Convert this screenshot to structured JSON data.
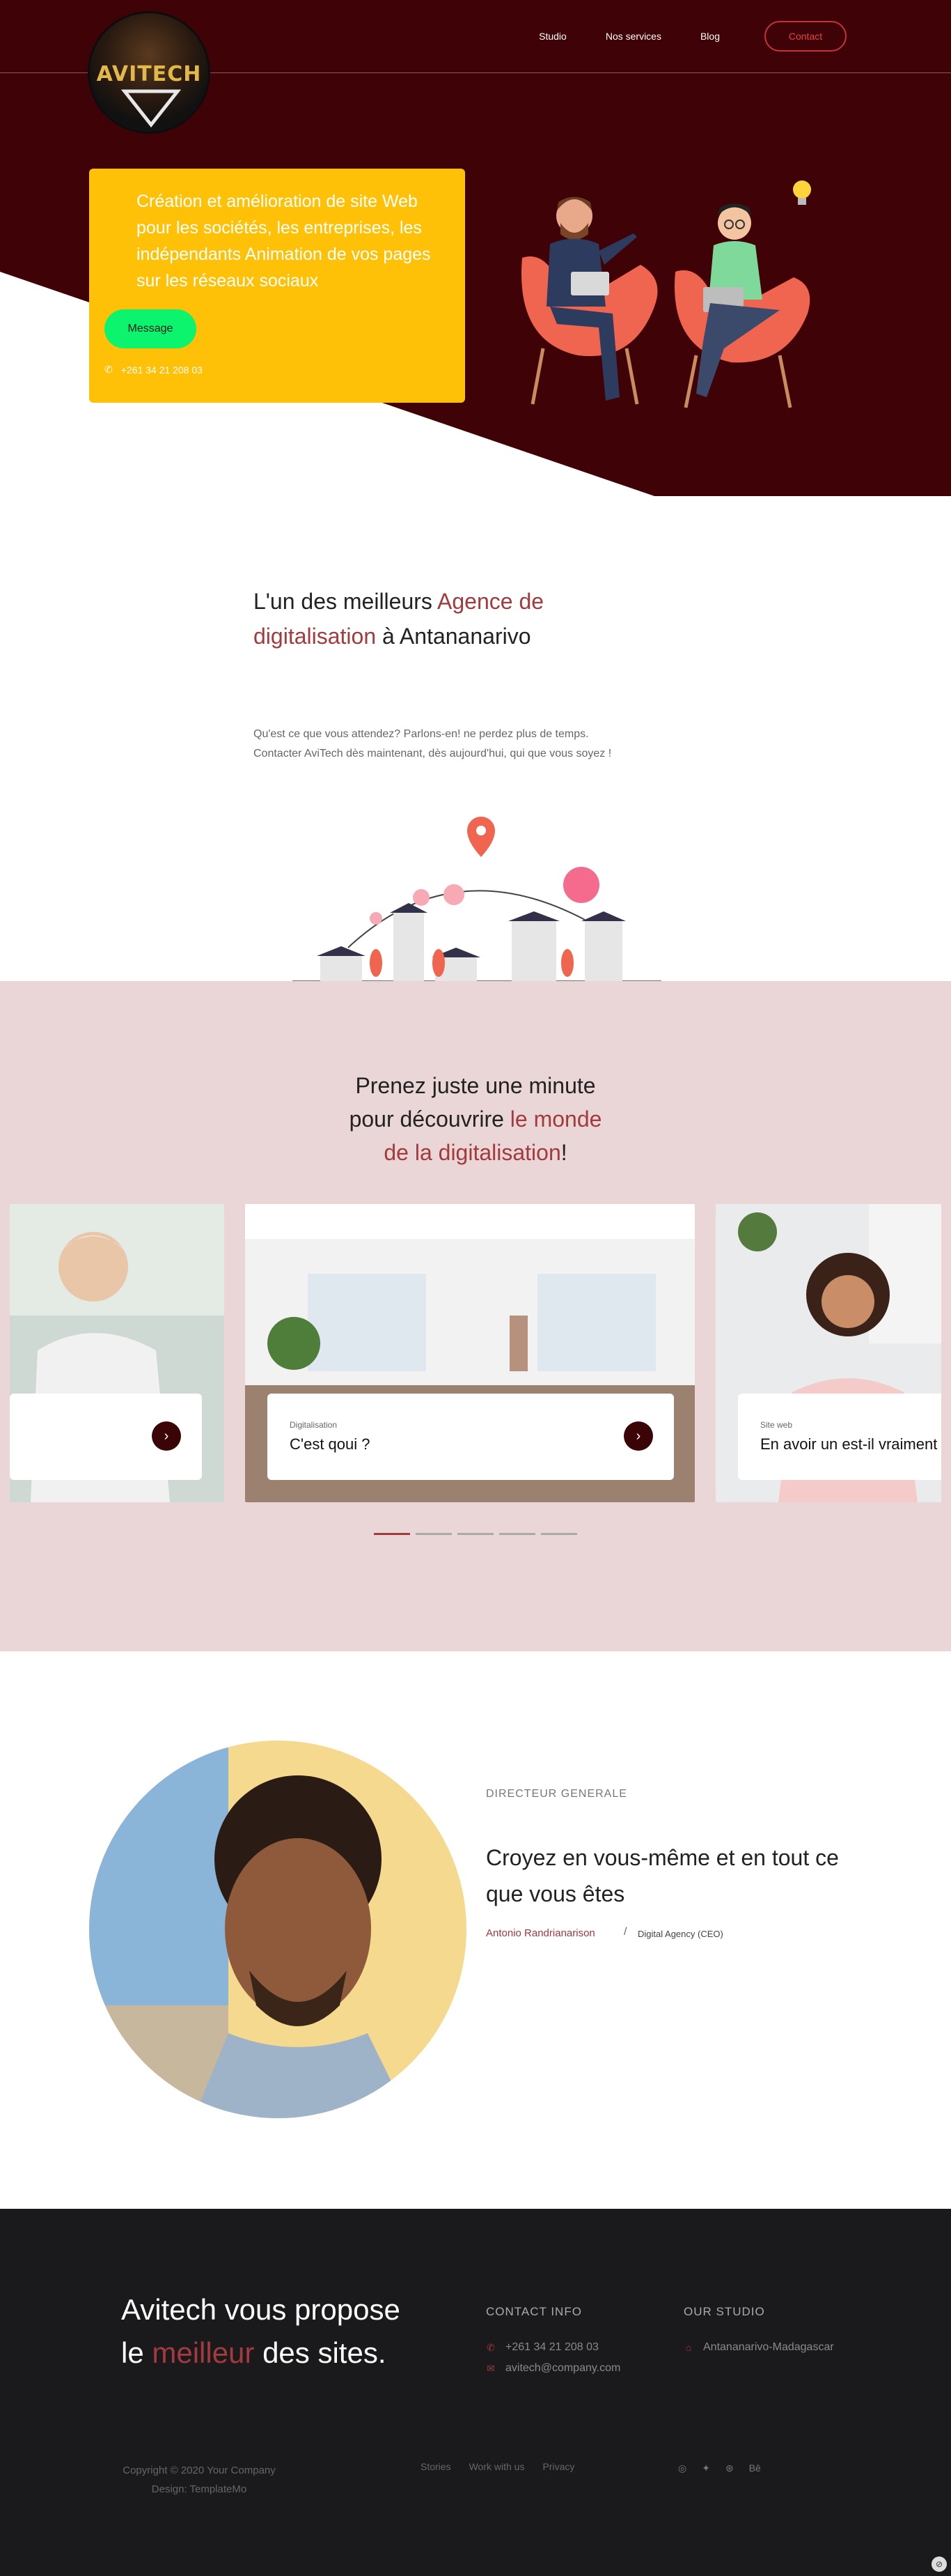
{
  "header": {
    "logo_text": "AVITECH",
    "nav": [
      "Studio",
      "Nos services",
      "Blog"
    ],
    "contact_label": "Contact"
  },
  "hero": {
    "headline": "Création et amélioration de site Web pour les sociétés, les entreprises, les indépendants Animation de vos pages sur les réseaux sociaux",
    "button_label": "Message",
    "phone": "+261 34 21 208 03"
  },
  "agency": {
    "title_1": "L'un des meilleurs ",
    "title_accent": "Agence de digitalisation",
    "title_2": " à Antananarivo",
    "text_1": "Qu'est ce que vous attendez? Parlons-en! ne perdez plus de temps.",
    "text_2": "Contacter AviTech dès maintenant, dès aujourd'hui, qui que vous soyez !"
  },
  "discover": {
    "line_1": "Prenez juste une minute",
    "line_2": "pour découvrire ",
    "accent_1": "le monde",
    "accent_2": "de la digitalisation",
    "end": "!",
    "slides": [
      {
        "category": "",
        "title": ""
      },
      {
        "category": "Digitalisation",
        "title": "C'est qoui ?"
      },
      {
        "category": "Site web",
        "title": "En avoir un est-il vraiment"
      }
    ]
  },
  "director": {
    "role": "DIRECTEUR GENERALE",
    "quote": "Croyez en vous-même et en tout ce que vous êtes",
    "name": "Antonio Randrianarison",
    "separator": "/",
    "company": "Digital Agency (CEO)"
  },
  "footer": {
    "title_1": "Avitech vous propose",
    "title_2": "le ",
    "title_accent": "meilleur",
    "title_3": " des sites.",
    "contact_head": "CONTACT INFO",
    "phone": "+261 34 21 208 03",
    "email": "avitech@company.com",
    "studio_head": "OUR STUDIO",
    "address": "Antananarivo-Madagascar",
    "copyright_1": "Copyright © 2020 Your Company",
    "copyright_2": "Design: TemplateMo",
    "links": [
      "Stories",
      "Work with us",
      "Privacy"
    ],
    "social": [
      "instagram-icon",
      "twitter-icon",
      "dribbble-icon",
      "behance-icon"
    ],
    "behance_label": "Bē"
  },
  "colors": {
    "hero_bg": "#3f0206",
    "card_yellow": "#fec107",
    "button_green": "#0cf36e",
    "accent": "#a23a3e",
    "pink_bg": "#ead6d6",
    "footer_bg": "#1a1a1c"
  }
}
